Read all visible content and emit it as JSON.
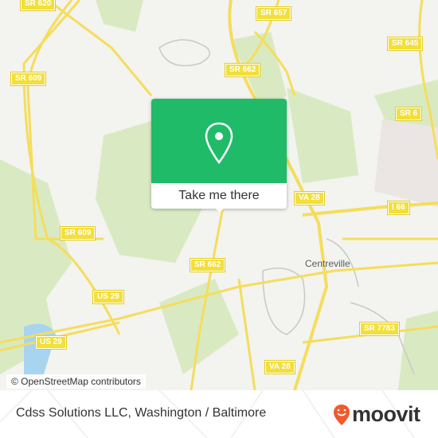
{
  "map": {
    "road_labels": [
      "SR 620",
      "SR 657",
      "SR 645",
      "SR 662",
      "SR 609",
      "SR 6",
      "VA 28",
      "I 66",
      "SR 609",
      "SR 662",
      "US 29",
      "US 29",
      "SR 7783",
      "VA 28"
    ],
    "places": [
      "Centreville"
    ],
    "attribution": "© OpenStreetMap contributors",
    "colors": {
      "land": "#f3f3ef",
      "park": "#d7e9bf",
      "water": "#a9d4f0",
      "road": "#f5dd5c",
      "shield": "#f2df3a"
    }
  },
  "popup": {
    "icon": "location-pin-icon",
    "button_label": "Take me there",
    "color": "#20bb68"
  },
  "footer": {
    "title": "Cdss Solutions LLC, Washington / Baltimore",
    "logo": "moovit",
    "logo_color": "#f15a2b"
  }
}
